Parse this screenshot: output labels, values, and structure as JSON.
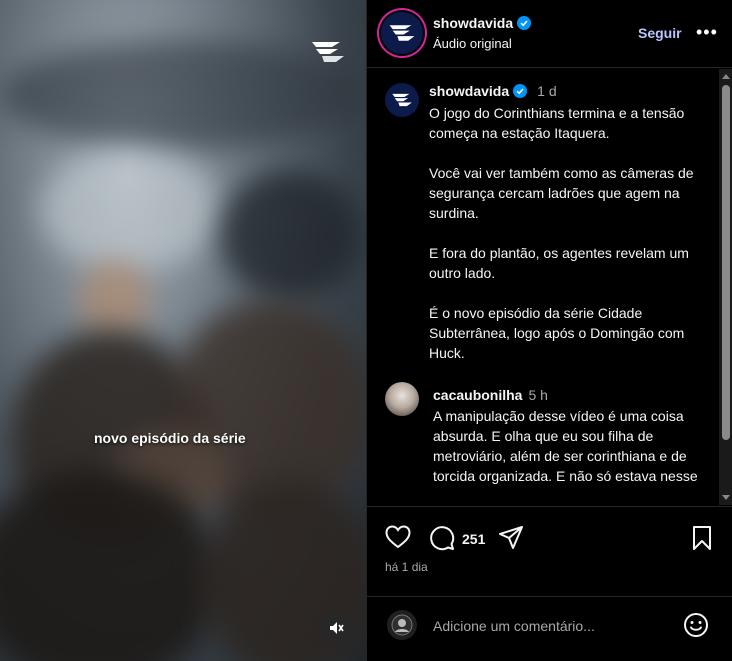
{
  "media": {
    "caption": "novo episódio da série",
    "logo_icon": "showdavida-logo-icon",
    "mute_icon": "speaker-muted-icon"
  },
  "header": {
    "username": "showdavida",
    "subtitle": "Áudio original",
    "follow_label": "Seguir",
    "more_label": "•••",
    "follow_color": "#b8c3ff"
  },
  "post": {
    "username": "showdavida",
    "time": "1 d",
    "paragraphs": [
      "O jogo do Corinthians termina e a tensão começa na estação Itaquera.",
      "Você vai ver também como as câmeras de segurança cercam ladrões que agem na surdina.",
      "E fora do plantão, os agentes revelam um outro lado.",
      "É o novo episódio da série Cidade Subterrânea, logo após o Domingão com Huck."
    ]
  },
  "comment": {
    "username": "cacaubonilha",
    "time": "5 h",
    "text": "A manipulação desse vídeo é uma coisa absurda. E olha que eu sou filha de metroviário, além de ser corinthiana e de torcida organizada. E não só estava nesse"
  },
  "actions": {
    "comment_count": "251",
    "posted_ago": "há 1 dia"
  },
  "add_comment": {
    "placeholder": "Adicione um comentário..."
  },
  "colors": {
    "verified": "#0095f6",
    "accent_ring": "#d6249f",
    "background": "#000000"
  }
}
